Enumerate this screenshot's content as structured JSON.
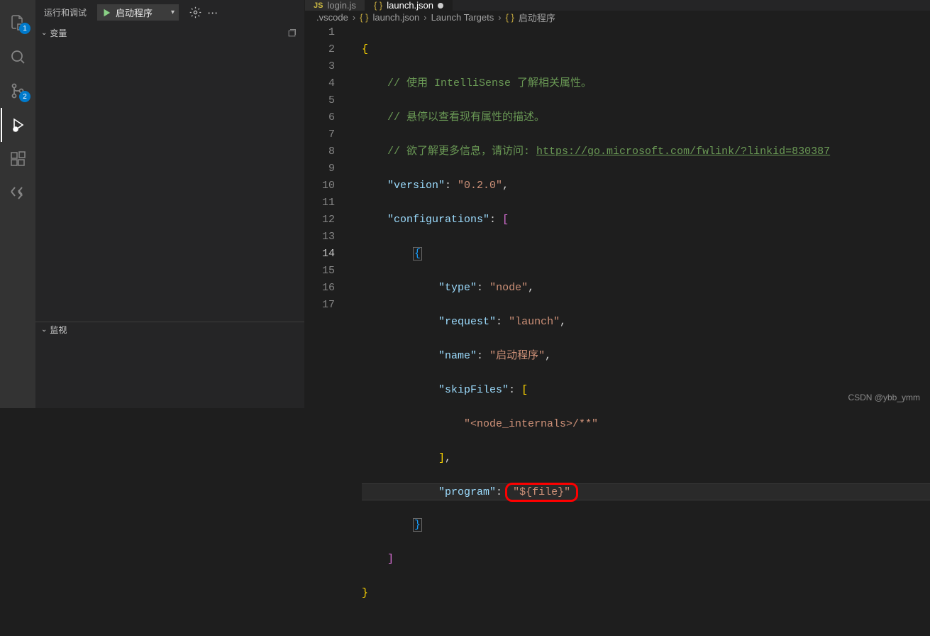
{
  "activity_bar": {
    "badges": {
      "explorer": "1",
      "scm": "2"
    }
  },
  "sidebar": {
    "title": "运行和调试",
    "config_name": "启动程序",
    "variables_label": "变量",
    "watch_label": "监视"
  },
  "tabs": [
    {
      "icon": "JS",
      "label": "login.js",
      "modified": false
    },
    {
      "label": "launch.json",
      "modified": true
    }
  ],
  "breadcrumb": {
    "folder": ".vscode",
    "file": "launch.json",
    "section": "Launch Targets",
    "item": "启动程序"
  },
  "editor": {
    "lines": [
      1,
      2,
      3,
      4,
      5,
      6,
      7,
      8,
      9,
      10,
      11,
      12,
      13,
      14,
      15,
      16,
      17
    ],
    "active_line": 14,
    "content": {
      "comment1": "// 使用 IntelliSense 了解相关属性。",
      "comment2": "// 悬停以查看现有属性的描述。",
      "comment3": "// 欲了解更多信息，请访问: ",
      "url": "https://go.microsoft.com/fwlink/?linkid=830387",
      "k_version": "\"version\"",
      "v_version": "\"0.2.0\"",
      "k_configurations": "\"configurations\"",
      "k_type": "\"type\"",
      "v_type": "\"node\"",
      "k_request": "\"request\"",
      "v_request": "\"launch\"",
      "k_name": "\"name\"",
      "v_name": "\"启动程序\"",
      "k_skipFiles": "\"skipFiles\"",
      "v_skipfile_entry": "\"<node_internals>/**\"",
      "k_program": "\"program\"",
      "v_program": "\"${file}\""
    }
  },
  "watermark": "CSDN @ybb_ymm"
}
